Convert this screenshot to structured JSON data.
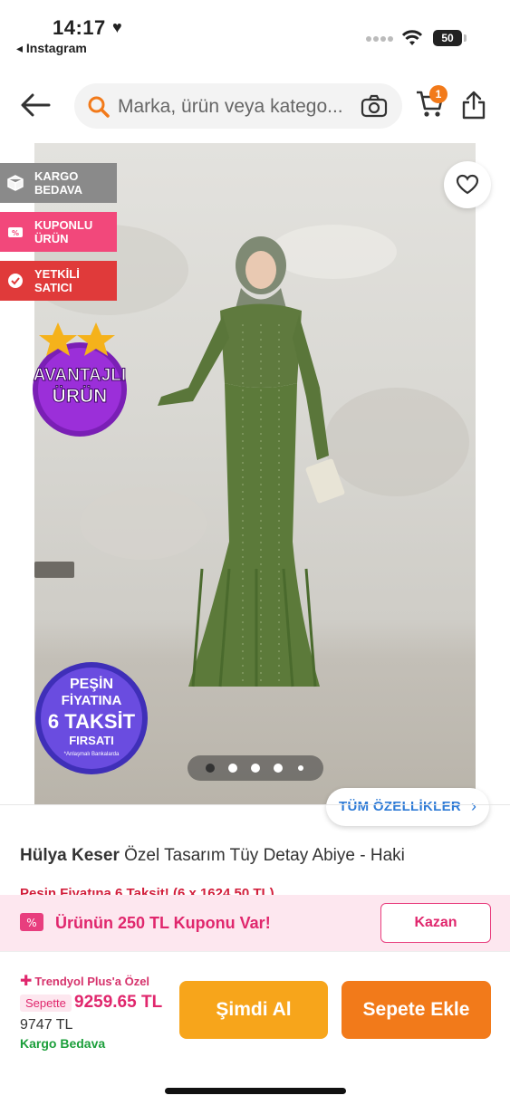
{
  "status_bar": {
    "time": "14:17",
    "back_app": "◂ Instagram",
    "battery": "50"
  },
  "header": {
    "search_placeholder": "Marka, ürün veya katego...",
    "cart_count": "1"
  },
  "image": {
    "tags": [
      {
        "line1": "KARGO",
        "line2": "BEDAVA",
        "color": "#8a8a8a"
      },
      {
        "line1": "KUPONLU",
        "line2": "ÜRÜN",
        "color": "#f2487b"
      },
      {
        "line1": "YETKİLİ",
        "line2": "SATICI",
        "color": "#e03a3a"
      }
    ],
    "badge_avantajli": {
      "line1": "AVANTAJLI",
      "line2": "ÜRÜN"
    },
    "badge_pesin": {
      "line1": "PEŞİN",
      "line2": "FİYATINA",
      "line3": "6 TAKSİT",
      "line4": "FIRSATI",
      "line5": "*Anlaşmalı Bankalarda"
    },
    "carousel_dots": 5,
    "carousel_active": 1,
    "all_features_label": "TÜM ÖZELLİKLER"
  },
  "product": {
    "brand": "Hülya Keser",
    "name": " Özel Tasarım Tüy Detay Abiye - Haki",
    "promo_partial": "Peşin Fiyatına 6 Taksit! (6 x 1624,50 TL)"
  },
  "coupon": {
    "text": "Ürünün 250 TL Kuponu Var!",
    "button": "Kazan"
  },
  "bottom": {
    "plus_label": "Trendyol Plus'a Özel",
    "sepette_label": "Sepette",
    "sepette_price": "9259.65 TL",
    "original_price": "9747 TL",
    "shipping": "Kargo Bedava",
    "buy_now": "Şimdi Al",
    "add_to_cart": "Sepete Ekle"
  },
  "colors": {
    "brand_orange": "#f27a1a",
    "buy_yellow": "#f7a51b",
    "coupon_pink": "#e0276d",
    "shipping_green": "#1c9f3b"
  }
}
